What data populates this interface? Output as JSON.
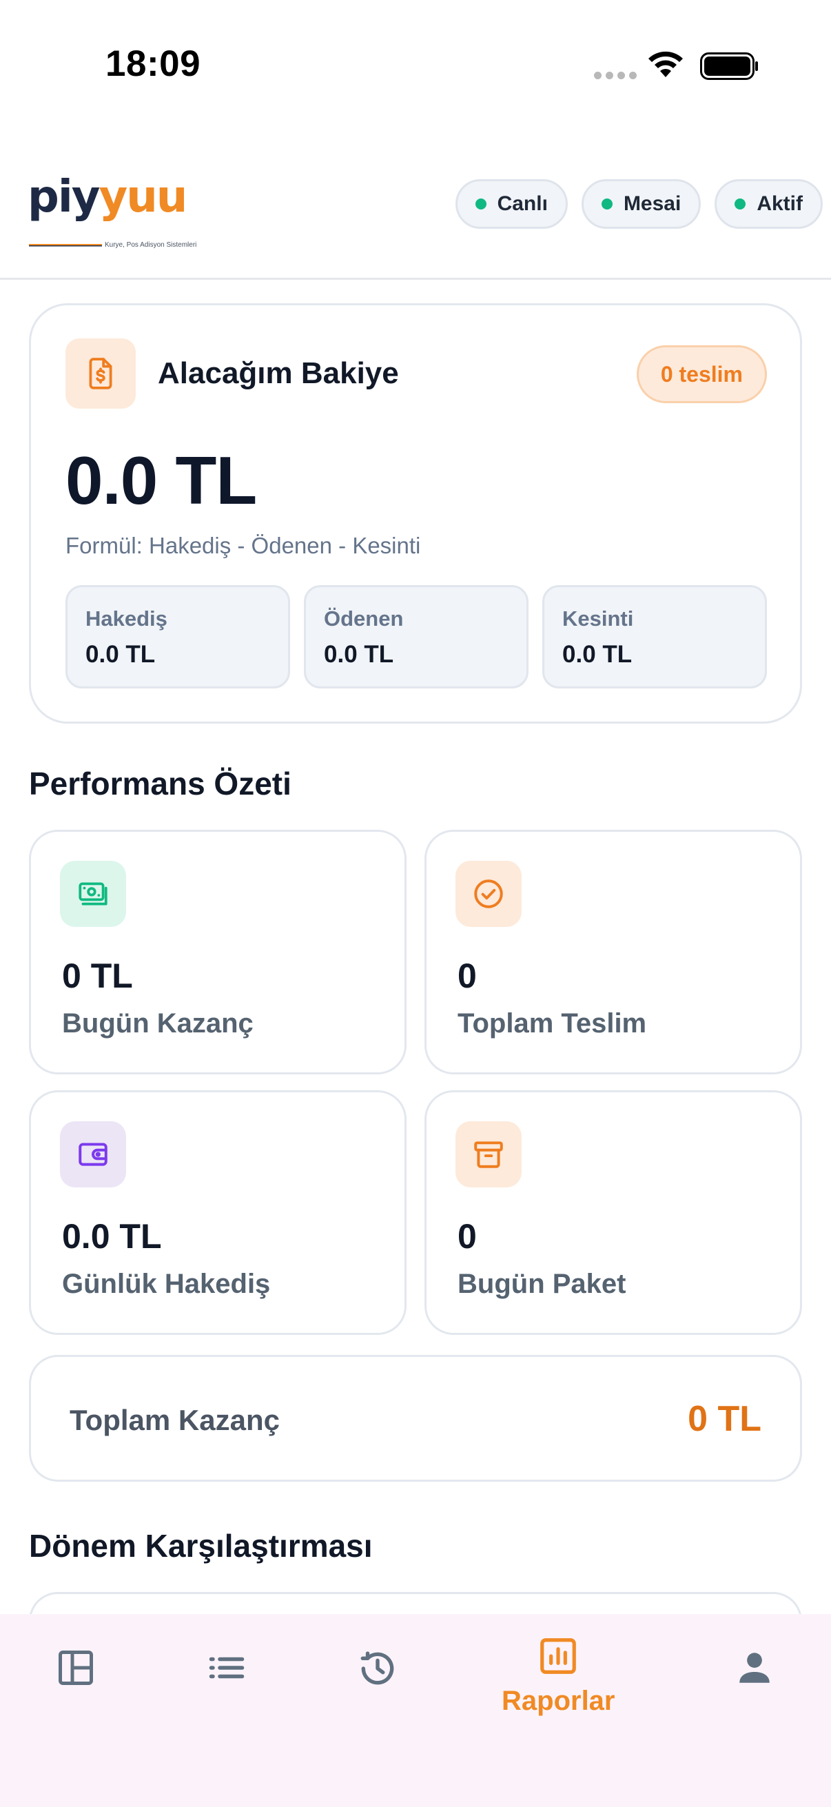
{
  "status_bar": {
    "time": "18:09"
  },
  "header": {
    "logo": {
      "text_part1": "piy",
      "text_part2": "yuu",
      "tagline": "Kurye, Pos Adisyon Sistemleri"
    },
    "pills": [
      {
        "label": "Canlı",
        "dot_color": "#10b981"
      },
      {
        "label": "Mesai",
        "dot_color": "#10b981"
      },
      {
        "label": "Aktif",
        "dot_color": "#10b981"
      }
    ]
  },
  "balance": {
    "icon": "receipt-dollar-icon",
    "title": "Alacağım Bakiye",
    "badge": "0 teslim",
    "amount": "0.0 TL",
    "formula": "Formül: Hakediş - Ödenen - Kesinti",
    "items": [
      {
        "label": "Hakediş",
        "value": "0.0 TL"
      },
      {
        "label": "Ödenen",
        "value": "0.0 TL"
      },
      {
        "label": "Kesinti",
        "value": "0.0 TL"
      }
    ]
  },
  "performance": {
    "title": "Performans Özeti",
    "cards": [
      {
        "icon": "money-icon",
        "value": "0 TL",
        "label": "Bugün Kazanç",
        "accent": "#10b981"
      },
      {
        "icon": "check-circle-icon",
        "value": "0",
        "label": "Toplam Teslim",
        "accent": "#f08a24"
      },
      {
        "icon": "wallet-icon",
        "value": "0.0 TL",
        "label": "Günlük Hakediş",
        "accent": "#7c3aed"
      },
      {
        "icon": "archive-box-icon",
        "value": "0",
        "label": "Bugün Paket",
        "accent": "#f08a24"
      }
    ],
    "total": {
      "label": "Toplam Kazanç",
      "value": "0 TL"
    }
  },
  "comparison": {
    "title": "Dönem Karşılaştırması"
  },
  "bottom_nav": {
    "items": [
      {
        "icon": "dashboard-icon",
        "label": ""
      },
      {
        "icon": "list-icon",
        "label": ""
      },
      {
        "icon": "history-icon",
        "label": ""
      },
      {
        "icon": "bar-chart-icon",
        "label": "Raporlar",
        "active": true
      },
      {
        "icon": "person-icon",
        "label": ""
      }
    ],
    "active_color": "#f08a24",
    "inactive_color": "#607080"
  }
}
